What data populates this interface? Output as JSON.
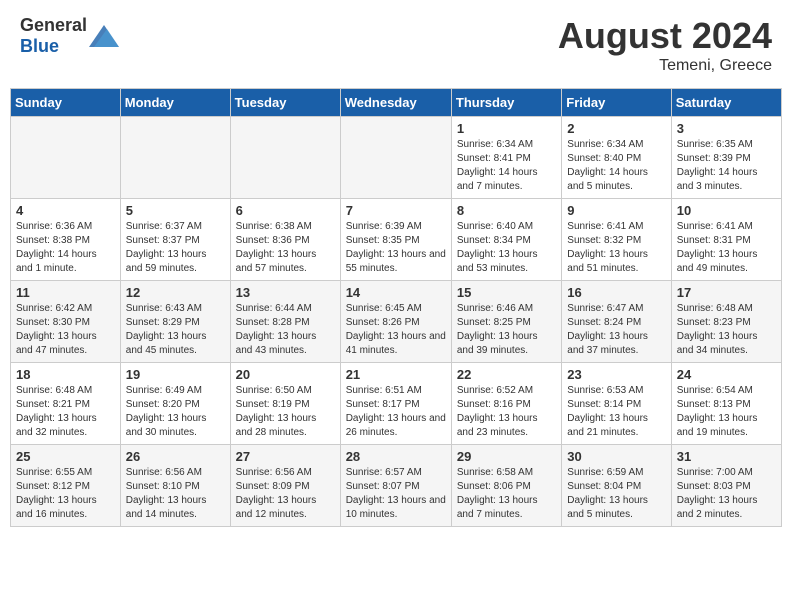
{
  "header": {
    "logo_general": "General",
    "logo_blue": "Blue",
    "title": "August 2024",
    "subtitle": "Temeni, Greece"
  },
  "days_of_week": [
    "Sunday",
    "Monday",
    "Tuesday",
    "Wednesday",
    "Thursday",
    "Friday",
    "Saturday"
  ],
  "weeks": [
    [
      {
        "day": "",
        "empty": true
      },
      {
        "day": "",
        "empty": true
      },
      {
        "day": "",
        "empty": true
      },
      {
        "day": "",
        "empty": true
      },
      {
        "day": "1",
        "sunrise": "6:34 AM",
        "sunset": "8:41 PM",
        "daylight": "14 hours and 7 minutes."
      },
      {
        "day": "2",
        "sunrise": "6:34 AM",
        "sunset": "8:40 PM",
        "daylight": "14 hours and 5 minutes."
      },
      {
        "day": "3",
        "sunrise": "6:35 AM",
        "sunset": "8:39 PM",
        "daylight": "14 hours and 3 minutes."
      }
    ],
    [
      {
        "day": "4",
        "sunrise": "6:36 AM",
        "sunset": "8:38 PM",
        "daylight": "14 hours and 1 minute."
      },
      {
        "day": "5",
        "sunrise": "6:37 AM",
        "sunset": "8:37 PM",
        "daylight": "13 hours and 59 minutes."
      },
      {
        "day": "6",
        "sunrise": "6:38 AM",
        "sunset": "8:36 PM",
        "daylight": "13 hours and 57 minutes."
      },
      {
        "day": "7",
        "sunrise": "6:39 AM",
        "sunset": "8:35 PM",
        "daylight": "13 hours and 55 minutes."
      },
      {
        "day": "8",
        "sunrise": "6:40 AM",
        "sunset": "8:34 PM",
        "daylight": "13 hours and 53 minutes."
      },
      {
        "day": "9",
        "sunrise": "6:41 AM",
        "sunset": "8:32 PM",
        "daylight": "13 hours and 51 minutes."
      },
      {
        "day": "10",
        "sunrise": "6:41 AM",
        "sunset": "8:31 PM",
        "daylight": "13 hours and 49 minutes."
      }
    ],
    [
      {
        "day": "11",
        "sunrise": "6:42 AM",
        "sunset": "8:30 PM",
        "daylight": "13 hours and 47 minutes."
      },
      {
        "day": "12",
        "sunrise": "6:43 AM",
        "sunset": "8:29 PM",
        "daylight": "13 hours and 45 minutes."
      },
      {
        "day": "13",
        "sunrise": "6:44 AM",
        "sunset": "8:28 PM",
        "daylight": "13 hours and 43 minutes."
      },
      {
        "day": "14",
        "sunrise": "6:45 AM",
        "sunset": "8:26 PM",
        "daylight": "13 hours and 41 minutes."
      },
      {
        "day": "15",
        "sunrise": "6:46 AM",
        "sunset": "8:25 PM",
        "daylight": "13 hours and 39 minutes."
      },
      {
        "day": "16",
        "sunrise": "6:47 AM",
        "sunset": "8:24 PM",
        "daylight": "13 hours and 37 minutes."
      },
      {
        "day": "17",
        "sunrise": "6:48 AM",
        "sunset": "8:23 PM",
        "daylight": "13 hours and 34 minutes."
      }
    ],
    [
      {
        "day": "18",
        "sunrise": "6:48 AM",
        "sunset": "8:21 PM",
        "daylight": "13 hours and 32 minutes."
      },
      {
        "day": "19",
        "sunrise": "6:49 AM",
        "sunset": "8:20 PM",
        "daylight": "13 hours and 30 minutes."
      },
      {
        "day": "20",
        "sunrise": "6:50 AM",
        "sunset": "8:19 PM",
        "daylight": "13 hours and 28 minutes."
      },
      {
        "day": "21",
        "sunrise": "6:51 AM",
        "sunset": "8:17 PM",
        "daylight": "13 hours and 26 minutes."
      },
      {
        "day": "22",
        "sunrise": "6:52 AM",
        "sunset": "8:16 PM",
        "daylight": "13 hours and 23 minutes."
      },
      {
        "day": "23",
        "sunrise": "6:53 AM",
        "sunset": "8:14 PM",
        "daylight": "13 hours and 21 minutes."
      },
      {
        "day": "24",
        "sunrise": "6:54 AM",
        "sunset": "8:13 PM",
        "daylight": "13 hours and 19 minutes."
      }
    ],
    [
      {
        "day": "25",
        "sunrise": "6:55 AM",
        "sunset": "8:12 PM",
        "daylight": "13 hours and 16 minutes."
      },
      {
        "day": "26",
        "sunrise": "6:56 AM",
        "sunset": "8:10 PM",
        "daylight": "13 hours and 14 minutes."
      },
      {
        "day": "27",
        "sunrise": "6:56 AM",
        "sunset": "8:09 PM",
        "daylight": "13 hours and 12 minutes."
      },
      {
        "day": "28",
        "sunrise": "6:57 AM",
        "sunset": "8:07 PM",
        "daylight": "13 hours and 10 minutes."
      },
      {
        "day": "29",
        "sunrise": "6:58 AM",
        "sunset": "8:06 PM",
        "daylight": "13 hours and 7 minutes."
      },
      {
        "day": "30",
        "sunrise": "6:59 AM",
        "sunset": "8:04 PM",
        "daylight": "13 hours and 5 minutes."
      },
      {
        "day": "31",
        "sunrise": "7:00 AM",
        "sunset": "8:03 PM",
        "daylight": "13 hours and 2 minutes."
      }
    ]
  ]
}
